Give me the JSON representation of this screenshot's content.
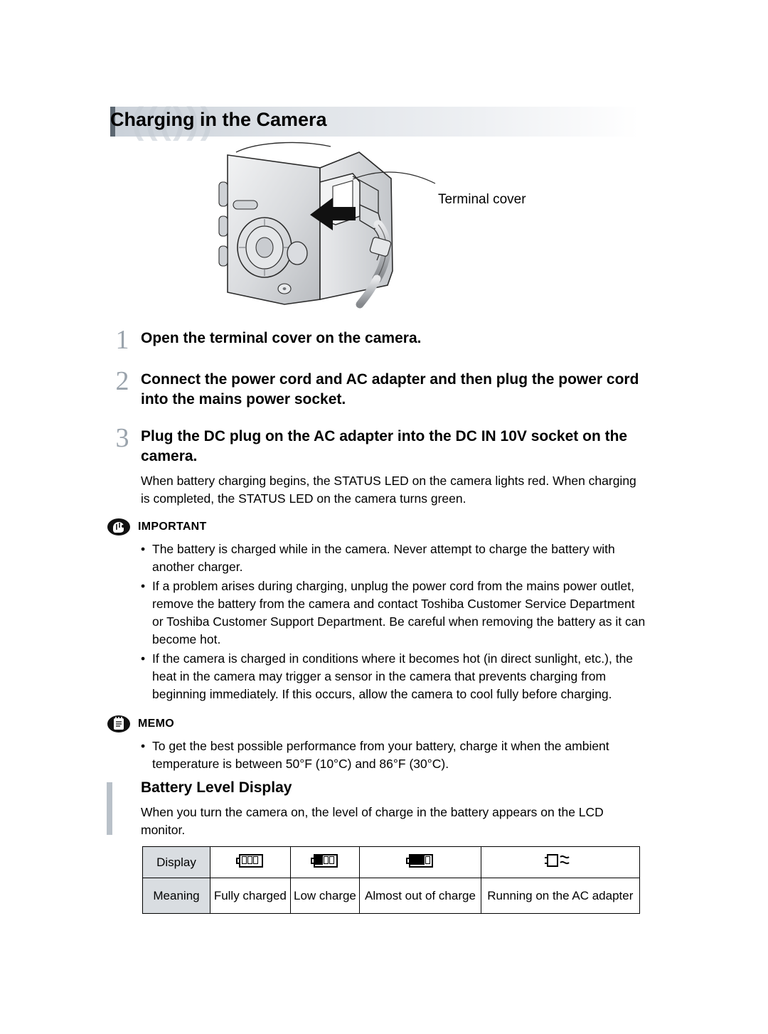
{
  "page": {
    "title": "Charging in the Camera",
    "illustration": {
      "callout": "Terminal cover"
    },
    "steps": [
      {
        "number": "1",
        "heading": "Open the terminal cover on the camera.",
        "body": ""
      },
      {
        "number": "2",
        "heading": "Connect the power cord and AC adapter and then plug the power cord into the mains power socket.",
        "body": ""
      },
      {
        "number": "3",
        "heading": "Plug the DC plug on the AC adapter into the DC IN 10V socket on the camera.",
        "body": "When battery charging begins, the STATUS LED on the camera lights red. When charging is completed, the STATUS LED on the camera turns green."
      }
    ],
    "important": {
      "title": "IMPORTANT",
      "icon": "pointing-hand-icon",
      "bullets": [
        "The battery is charged while in the camera. Never attempt to charge the battery with another charger.",
        "If a problem arises during charging, unplug the power cord from the mains power outlet, remove the battery from the camera and contact Toshiba Customer Service Department or Toshiba Customer Support Department. Be careful when removing the battery as it can become hot.",
        "If the camera is charged in conditions where it becomes hot (in direct sunlight, etc.), the heat in the camera may trigger a sensor in the camera that prevents charging from beginning immediately. If this occurs, allow the camera to cool fully before charging."
      ]
    },
    "memo": {
      "title": "MEMO",
      "icon": "memo-pad-icon",
      "bullets": [
        "To get the best possible performance from your battery, charge it when the ambient temperature is between 50°F (10°C) and 86°F (30°C)."
      ]
    },
    "subsection": {
      "title": "Battery Level Display",
      "body": "When you turn the camera on, the level of charge in the battery appears on the LCD monitor."
    },
    "table": {
      "row_headers": [
        "Display",
        "Meaning"
      ],
      "columns": [
        {
          "icon": "battery-full-icon",
          "meaning": "Fully charged"
        },
        {
          "icon": "battery-low-icon",
          "meaning": "Low charge"
        },
        {
          "icon": "battery-empty-icon",
          "meaning": "Almost out of charge"
        },
        {
          "icon": "ac-plug-icon",
          "meaning": "Running on the AC adapter"
        }
      ]
    }
  }
}
